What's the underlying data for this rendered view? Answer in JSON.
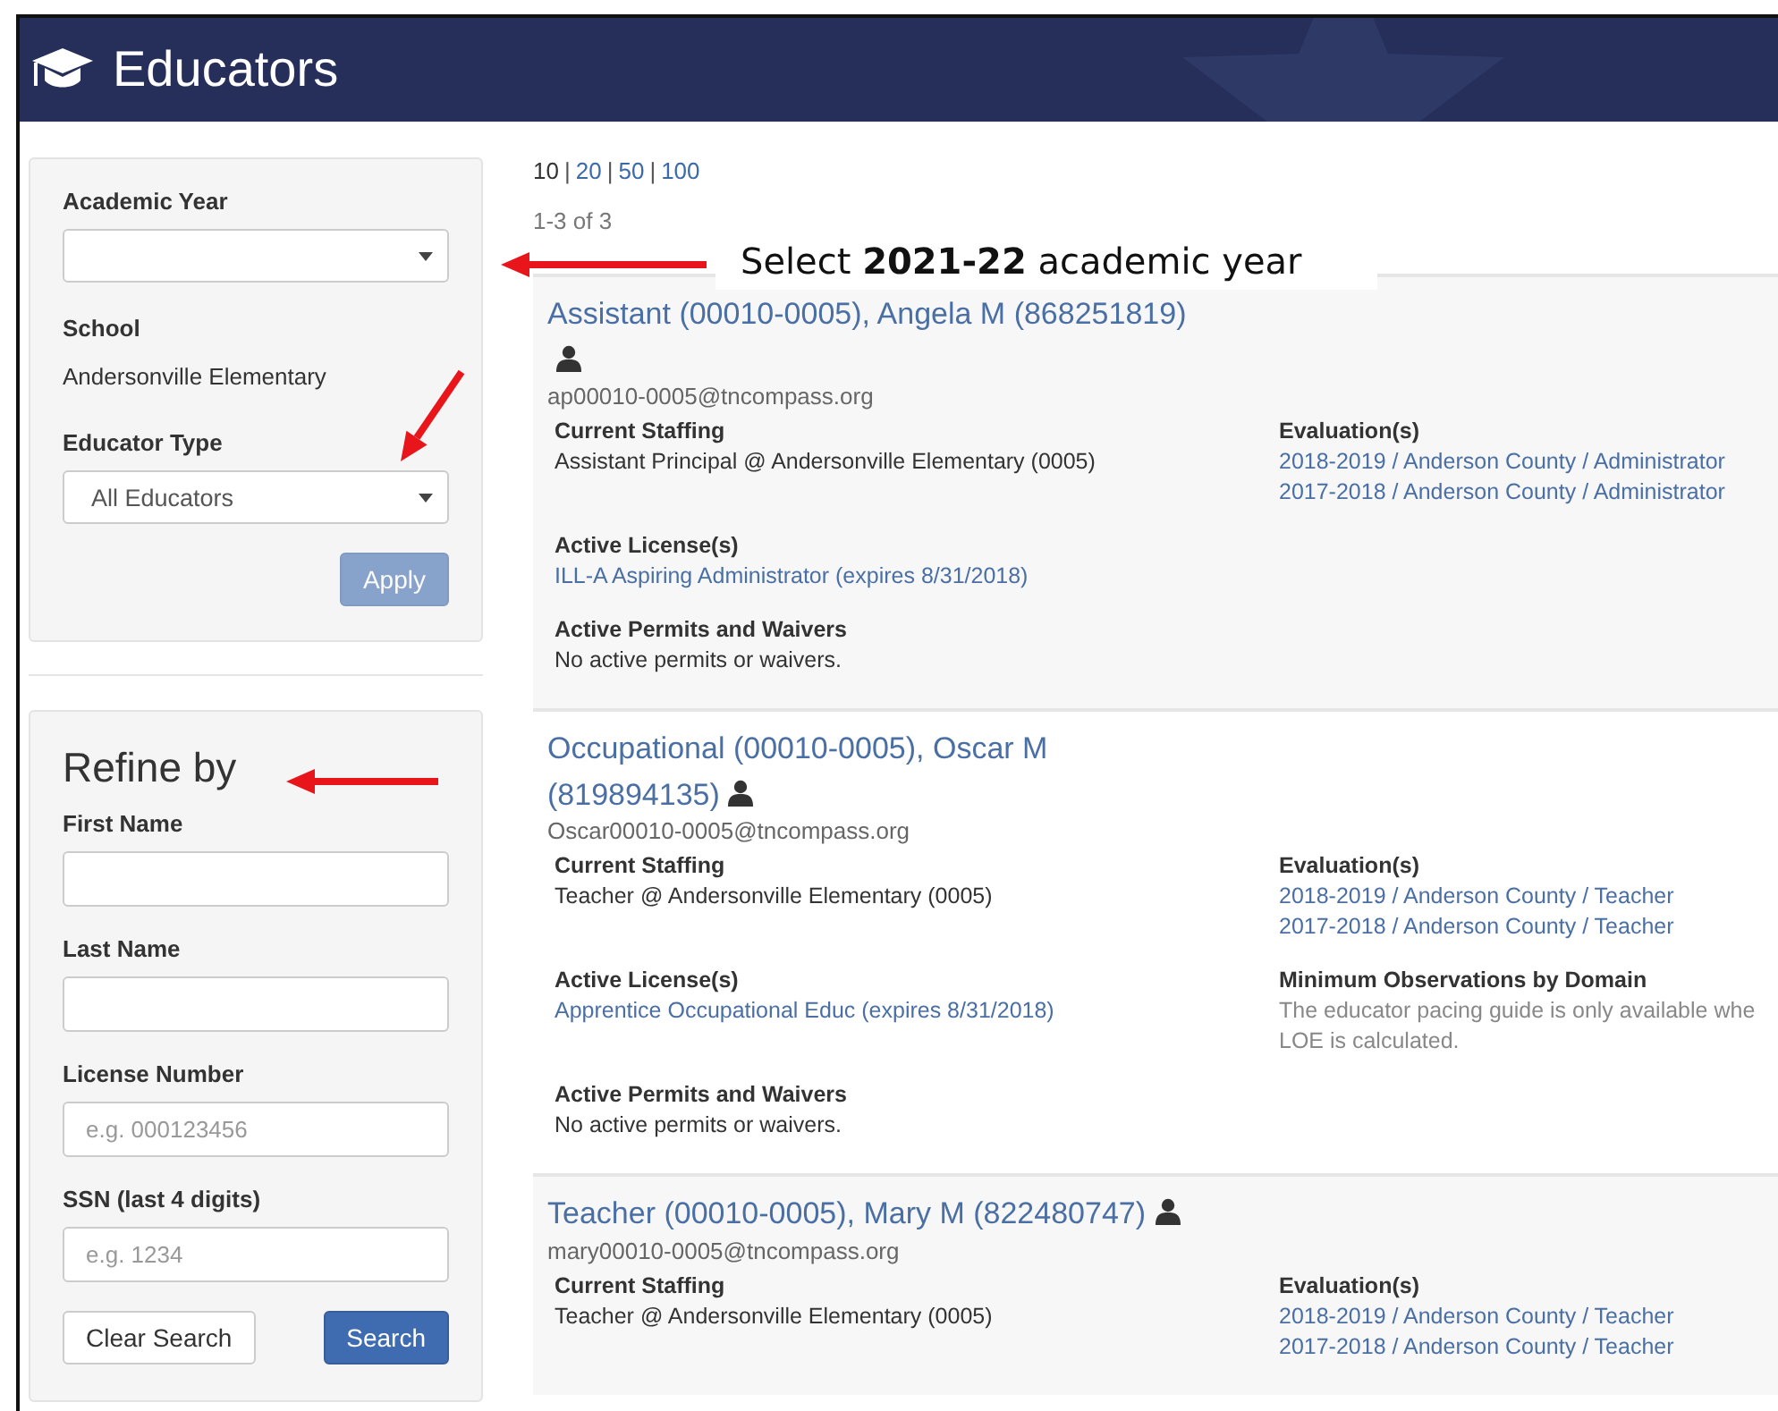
{
  "header": {
    "title": "Educators"
  },
  "filters": {
    "fields": [
      {
        "label": "Academic Year",
        "kind": "select"
      },
      {
        "label": "School",
        "kind": "static",
        "value": "Andersonville Elementary"
      },
      {
        "label": "Educator Type",
        "kind": "select",
        "value": "All Educators"
      }
    ],
    "apply_button": {
      "label": "Apply",
      "disabled": true
    }
  },
  "refine": {
    "title": "Refine by",
    "fields": [
      {
        "label": "First Name"
      },
      {
        "label": "Last Name"
      },
      {
        "label": "License Number",
        "placeholder": "e.g. 000123456"
      },
      {
        "label": "SSN (last 4 digits)",
        "placeholder": "e.g. 1234"
      }
    ],
    "clear_button": "Clear Search",
    "search_button": "Search"
  },
  "page_sizes": [
    {
      "label": "10",
      "selected": true
    },
    {
      "label": "20",
      "selected": false
    },
    {
      "label": "50",
      "selected": false
    },
    {
      "label": "100",
      "selected": false
    }
  ],
  "page_size_separator": "|",
  "result_count": "1-3 of 3",
  "educators": [
    {
      "name": "Assistant (00010-0005), Angela M (868251819)",
      "email": "ap00010-0005@tncompass.org",
      "rows": [
        [
          {
            "title": "Current Staffing",
            "lines": [
              {
                "text": "Assistant Principal @ Andersonville Elementary (0005)",
                "kind": "text"
              }
            ]
          },
          {
            "title": "Evaluation(s)",
            "lines": [
              {
                "text": "2018-2019 / Anderson County / Administrator",
                "kind": "link"
              },
              {
                "text": "2017-2018 / Anderson County / Administrator",
                "kind": "link"
              }
            ]
          }
        ],
        [
          {
            "title": "Active License(s)",
            "lines": [
              {
                "text": "ILL-A Aspiring Administrator (expires 8/31/2018)",
                "kind": "link"
              }
            ]
          }
        ],
        [
          {
            "title": "Active Permits and Waivers",
            "lines": [
              {
                "text": "No active permits or waivers.",
                "kind": "text"
              }
            ]
          }
        ]
      ]
    },
    {
      "name": "Occupational (00010-0005), Oscar M (819894135)",
      "email": "Oscar00010-0005@tncompass.org",
      "rows": [
        [
          {
            "title": "Current Staffing",
            "lines": [
              {
                "text": "Teacher @ Andersonville Elementary (0005)",
                "kind": "text"
              }
            ]
          },
          {
            "title": "Evaluation(s)",
            "lines": [
              {
                "text": "2018-2019 / Anderson County / Teacher",
                "kind": "link"
              },
              {
                "text": "2017-2018 / Anderson County / Teacher",
                "kind": "link"
              }
            ]
          }
        ],
        [
          {
            "title": "Active License(s)",
            "lines": [
              {
                "text": "Apprentice Occupational Educ (expires 8/31/2018)",
                "kind": "link"
              }
            ]
          },
          {
            "title": "Minimum Observations by Domain",
            "lines": [
              {
                "text": "The educator pacing guide is only available whe",
                "kind": "muted"
              },
              {
                "text": "LOE is calculated.",
                "kind": "muted"
              }
            ]
          }
        ],
        [
          {
            "title": "Active Permits and Waivers",
            "lines": [
              {
                "text": "No active permits or waivers.",
                "kind": "text"
              }
            ]
          }
        ]
      ]
    },
    {
      "name": "Teacher (00010-0005), Mary M (822480747)",
      "email": "mary00010-0005@tncompass.org",
      "rows": [
        [
          {
            "title": "Current Staffing",
            "lines": [
              {
                "text": "Teacher @ Andersonville Elementary (0005)",
                "kind": "text"
              }
            ]
          },
          {
            "title": "Evaluation(s)",
            "lines": [
              {
                "text": "2018-2019 / Anderson County / Teacher",
                "kind": "link"
              },
              {
                "text": "2017-2018 / Anderson County / Teacher",
                "kind": "link"
              }
            ]
          }
        ]
      ]
    }
  ],
  "annotation": {
    "text": "Select **2021-22** academic year"
  }
}
